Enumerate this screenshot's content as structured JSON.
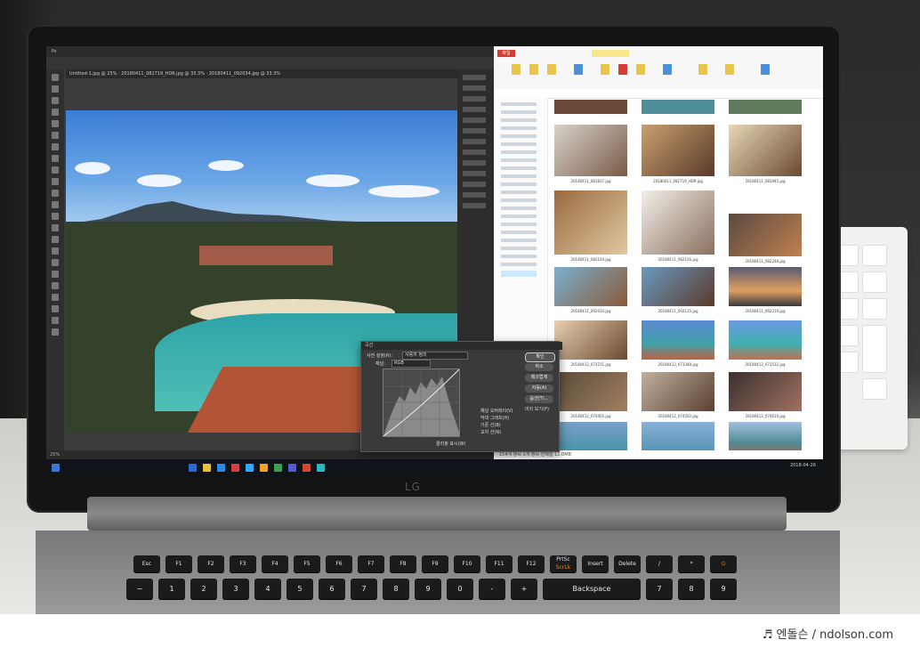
{
  "photo": {
    "ps_tabs": "Untitled-1.jpg @ 25%  ·  20180411_082719_HDR.jpg @ 33.3%  ·  20180411_092034.jpg @ 33.3%",
    "ps_status": "25%",
    "curves_dialog": {
      "title": "곡선",
      "preset_label": "사전 설정(R):",
      "preset_value": "사용자 정의",
      "channel_label": "채널:",
      "channel_value": "RGB",
      "ok": "확인",
      "cancel": "취소",
      "smooth": "매끄럽게",
      "auto": "자동(A)",
      "options": "옵션(T)...",
      "preview": "미리 보기(P)",
      "display_options": [
        "채널 오버레이(V)",
        "막대 그래프(H)",
        "기준 선(B)",
        "교차 선(N)"
      ],
      "show_clipping": "클리핑 표시(W)"
    },
    "explorer": {
      "file_tab": "파일",
      "status": "154개 항목   1개 항목 선택함 11.0MB",
      "thumbnails": [
        "20180411_081837.jpg",
        "20180411_082719_HDR.jpg",
        "20180411_081945.jpg",
        "20180411_082104.jpg",
        "20180411_082156.jpg",
        "20180411_082248.jpg",
        "20180411_092034.jpg",
        "20180411_092115.jpg",
        "20180411_092210.jpg",
        "20180412_073211.jpg",
        "20180412_073348.jpg",
        "20180412_073512.jpg",
        "20180412_074405.jpg",
        "20180412_074502.jpg",
        "20180412_074610.jpg",
        "20180412_080118.jpg",
        "20180412_080240.jpg",
        "20180412_080352.jpg"
      ]
    },
    "taskbar_clock": "2018-04-26",
    "brand_logo": "LG",
    "function_keys": [
      "Esc",
      "F1",
      "F2",
      "F3",
      "F4",
      "F5",
      "F6",
      "F7",
      "F8",
      "F9",
      "F10",
      "F11",
      "F12",
      "PrtSc",
      "Insert",
      "Delete",
      "/",
      "*",
      "⏻"
    ],
    "function_sub": [
      "",
      "",
      "",
      "",
      "",
      "",
      "",
      "",
      "",
      "",
      "",
      "",
      "",
      "ScrLk",
      "",
      "",
      "",
      "",
      ""
    ],
    "number_keys": [
      "~",
      "1",
      "2",
      "3",
      "4",
      "5",
      "6",
      "7",
      "8",
      "9",
      "0",
      "-",
      "+",
      "Backspace",
      "7",
      "8",
      "9"
    ]
  },
  "credit": "♬ 엔돌슨 / ndolson.com",
  "colors": {
    "accent_orange": "#f08a2c",
    "explorer_file_tab": "#d43c36",
    "sea": "#2ea3a8"
  }
}
